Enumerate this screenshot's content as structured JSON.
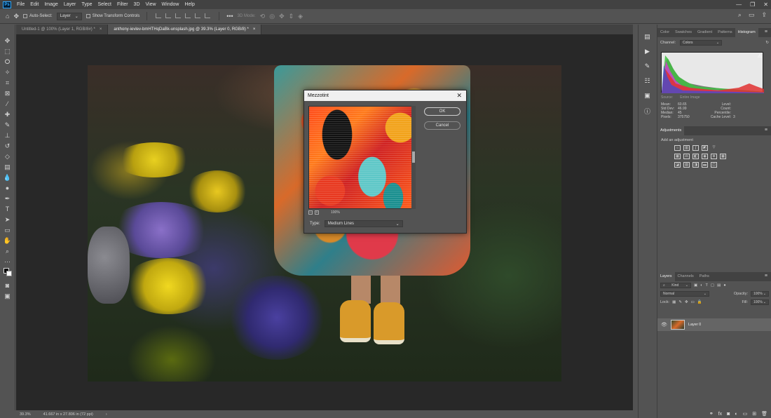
{
  "menubar": {
    "logo": "Ps",
    "items": [
      "File",
      "Edit",
      "Image",
      "Layer",
      "Type",
      "Select",
      "Filter",
      "3D",
      "View",
      "Window",
      "Help"
    ],
    "window_controls": [
      "—",
      "❐",
      "✕"
    ]
  },
  "options": {
    "auto_select_label": "Auto-Select:",
    "auto_select_value": "Layer",
    "show_transform_label": "Show Transform Controls",
    "mode_3d_label": "3D Mode:"
  },
  "tabs": [
    {
      "label": "Untitled-1 @ 100% (Layer 1, RGB/8#) *",
      "close": "×"
    },
    {
      "label": "anthony-ievlev-bmHTHqDaBk-unsplash.jpg @ 39.3% (Layer 0, RGB/8) *",
      "close": "×"
    }
  ],
  "dialog": {
    "title": "Mezzotint",
    "close": "✕",
    "ok_label": "OK",
    "cancel_label": "Cancel",
    "zoom_value": "100%",
    "zoom_minus": "–",
    "zoom_plus": "+",
    "type_label": "Type:",
    "type_value": "Medium Lines"
  },
  "status": {
    "zoom": "39.3%",
    "doc_size": "41.667 in x 27.806 in (72 ppi)"
  },
  "histogram_panel": {
    "tabs": [
      "Color",
      "Swatches",
      "Gradient",
      "Patterns",
      "Histogram"
    ],
    "active_tab": "Histogram",
    "channel_label": "Channel:",
    "channel_value": "Colors",
    "source_label": "Source:",
    "source_value": "Entire Image",
    "stats": [
      {
        "label": "Mean:",
        "value": "60.65",
        "label2": "Level:",
        "value2": ""
      },
      {
        "label": "Std Dev:",
        "value": "46.99",
        "label2": "Count:",
        "value2": ""
      },
      {
        "label": "Median:",
        "value": "45",
        "label2": "Percentile:",
        "value2": ""
      },
      {
        "label": "Pixels:",
        "value": "375750",
        "label2": "Cache Level:",
        "value2": "3"
      }
    ],
    "warning_icon": "⚠"
  },
  "adjustments_panel": {
    "title": "Adjustments",
    "add_label": "Add an adjustment"
  },
  "layers_panel": {
    "tabs": [
      "Layers",
      "Channels",
      "Paths"
    ],
    "active_tab": "Layers",
    "kind_label": "Kind",
    "blend_mode": "Normal",
    "opacity_label": "Opacity:",
    "opacity_value": "100%",
    "lock_label": "Lock:",
    "fill_label": "Fill:",
    "fill_value": "100%",
    "layer_name": "Layer 0"
  },
  "colors": {
    "accent": "#31a8ff",
    "panel_bg": "#535353",
    "dark_bg": "#282828"
  }
}
